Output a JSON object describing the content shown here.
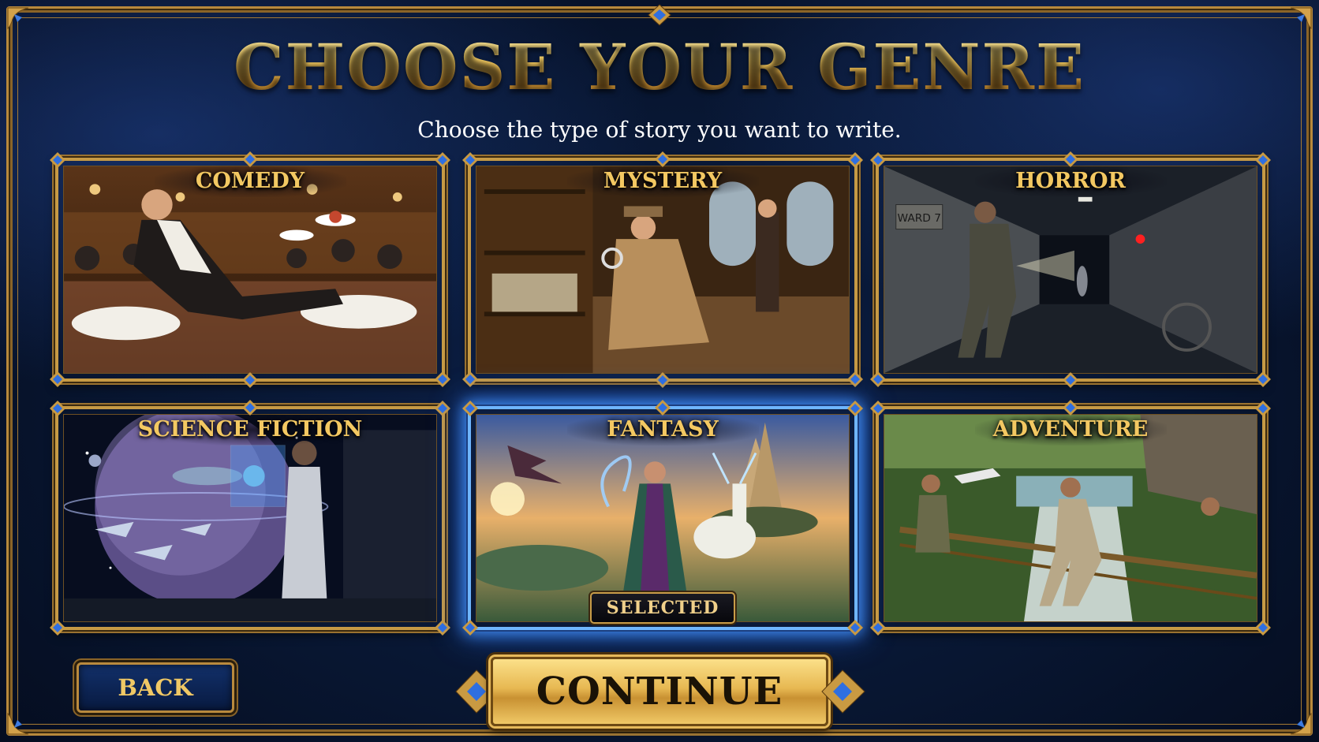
{
  "title": "CHOOSE YOUR GENRE",
  "subtitle": "Choose the type of story you want to write.",
  "genres": [
    {
      "label": "COMEDY",
      "scene": "restaurant-waiter-slipping"
    },
    {
      "label": "MYSTERY",
      "scene": "detective-with-magnifying-glass"
    },
    {
      "label": "HORROR",
      "scene": "abandoned-hospital-corridor"
    },
    {
      "label": "SCIENCE FICTION",
      "scene": "spaceship-window-astronaut"
    },
    {
      "label": "FANTASY",
      "scene": "sorceress-dragon-floating-castle"
    },
    {
      "label": "ADVENTURE",
      "scene": "jungle-rope-bridge-waterfall"
    }
  ],
  "selected": {
    "genre": "FANTASY",
    "badge": "SELECTED"
  },
  "buttons": {
    "back": "BACK",
    "continue": "CONTINUE"
  },
  "horror_sign": "WARD 7",
  "colors": {
    "gold": "#f0c85a",
    "frame_gold": "#c69a45",
    "selected_glow": "#6fb6ff",
    "background": "#081631"
  }
}
